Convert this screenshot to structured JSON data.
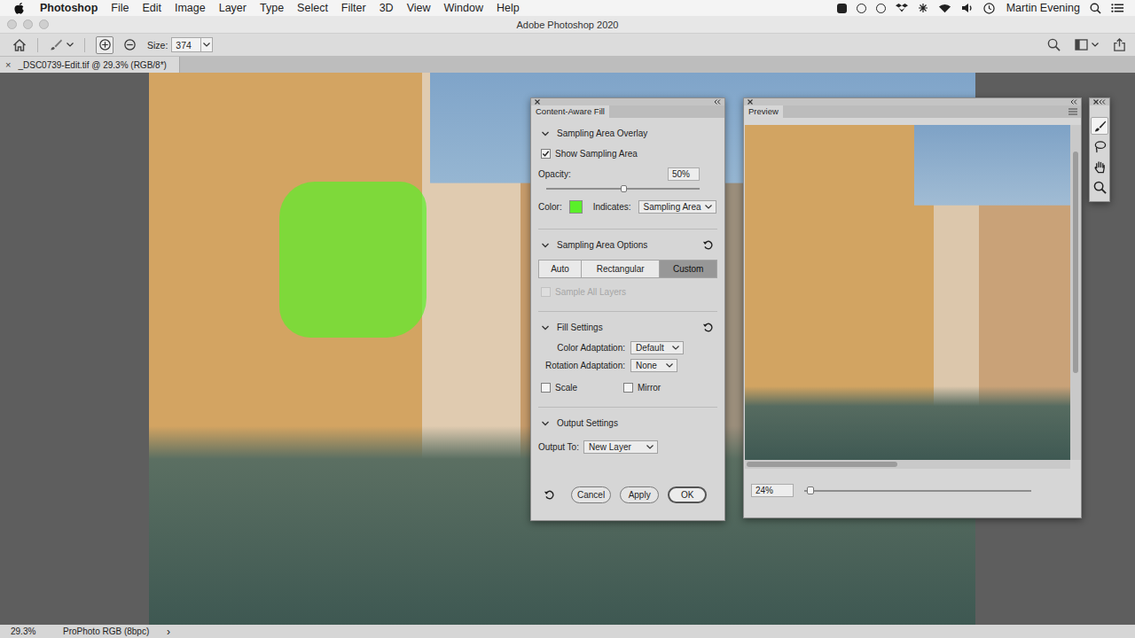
{
  "menubar": {
    "app": "Photoshop",
    "items": [
      "File",
      "Edit",
      "Image",
      "Layer",
      "Type",
      "Select",
      "Filter",
      "3D",
      "View",
      "Window",
      "Help"
    ],
    "user": "Martin Evening"
  },
  "window": {
    "title": "Adobe Photoshop 2020"
  },
  "options_bar": {
    "modes": [
      {
        "kind": "add",
        "selected": true
      },
      {
        "kind": "subtract",
        "selected": false
      }
    ],
    "size_label": "Size:",
    "size_value": "374"
  },
  "document_tab": {
    "close": "×",
    "title": "_DSC0739-Edit.tif @ 29.3% (RGB/8*)"
  },
  "content_aware_fill": {
    "tab": "Content-Aware Fill",
    "overlay": {
      "title": "Sampling Area Overlay",
      "expanded": true,
      "reset": false,
      "show": {
        "label": "Show Sampling Area",
        "checked": true
      },
      "opacity": {
        "label": "Opacity:",
        "value": "50%",
        "level": 0.5
      },
      "color": {
        "label": "Color:",
        "value": "#5af02a"
      },
      "indicates": {
        "label": "Indicates:",
        "value": "Sampling Area"
      }
    },
    "sampling": {
      "title": "Sampling Area Options",
      "expanded": true,
      "reset": true,
      "modes": [
        {
          "label": "Auto",
          "selected": false
        },
        {
          "label": "Rectangular",
          "selected": false
        },
        {
          "label": "Custom",
          "selected": true
        }
      ],
      "sample_all": {
        "label": "Sample All Layers",
        "checked": false,
        "disabled": true
      }
    },
    "fill": {
      "title": "Fill Settings",
      "expanded": true,
      "reset": true,
      "color_adaptation": {
        "label": "Color Adaptation:",
        "value": "Default"
      },
      "rotation_adaptation": {
        "label": "Rotation Adaptation:",
        "value": "None"
      },
      "options": [
        {
          "label": "Scale",
          "checked": false
        },
        {
          "label": "Mirror",
          "checked": false
        }
      ]
    },
    "output": {
      "title": "Output Settings",
      "expanded": true,
      "reset": false,
      "output_to": {
        "label": "Output To:",
        "value": "New Layer"
      }
    },
    "buttons": [
      {
        "label": "Cancel",
        "default": false
      },
      {
        "label": "Apply",
        "default": false
      },
      {
        "label": "OK",
        "default": true
      }
    ]
  },
  "preview": {
    "tab": "Preview",
    "zoom": "24%",
    "zoom_level": 0.02
  },
  "tools": [
    {
      "kind": "brush",
      "selected": true
    },
    {
      "kind": "lasso",
      "selected": false
    },
    {
      "kind": "hand",
      "selected": false
    },
    {
      "kind": "zoom",
      "selected": false
    }
  ],
  "status_bar": {
    "zoom": "29.3%",
    "profile": "ProPhoto RGB (8bpc)",
    "more": "›"
  }
}
